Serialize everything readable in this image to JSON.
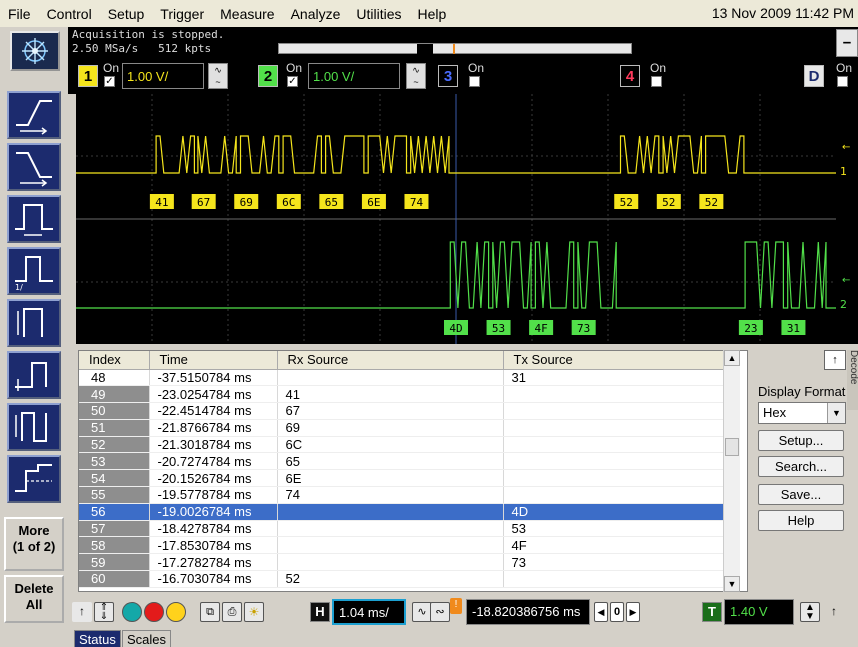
{
  "menu": {
    "items": [
      "File",
      "Control",
      "Setup",
      "Trigger",
      "Measure",
      "Analyze",
      "Utilities",
      "Help"
    ],
    "datetime": "13 Nov 2009 11:42 PM"
  },
  "status": {
    "acquisition": "Acquisition is stopped.",
    "sample_rate": "2.50 MSa/s",
    "memory_depth": "512 kpts",
    "right_button": "−"
  },
  "channels": [
    {
      "num": "1",
      "on_label": "On",
      "scale": "1.00 V/",
      "color": "#f5e51c",
      "enabled": true
    },
    {
      "num": "2",
      "on_label": "On",
      "scale": "1.00 V/",
      "color": "#52e04a",
      "enabled": true
    },
    {
      "num": "3",
      "on_label": "On",
      "color": "#4a6cff",
      "enabled": false
    },
    {
      "num": "4",
      "on_label": "On",
      "color": "#ff3a5c",
      "enabled": false
    },
    {
      "num": "D",
      "on_label": "On",
      "color": "#e8e8e8",
      "enabled": false
    }
  ],
  "scope": {
    "ch1_marker": "1",
    "ch2_marker": "2",
    "ch1_bytes": [
      {
        "label": "41",
        "at": 0.113
      },
      {
        "label": "67",
        "at": 0.168
      },
      {
        "label": "69",
        "at": 0.224
      },
      {
        "label": "6C",
        "at": 0.28
      },
      {
        "label": "65",
        "at": 0.336
      },
      {
        "label": "6E",
        "at": 0.392
      },
      {
        "label": "74",
        "at": 0.448
      },
      {
        "label": "52",
        "at": 0.724
      },
      {
        "label": "52",
        "at": 0.78
      },
      {
        "label": "52",
        "at": 0.836
      }
    ],
    "ch2_bytes": [
      {
        "label": "4D",
        "at": 0.5
      },
      {
        "label": "53",
        "at": 0.556
      },
      {
        "label": "4F",
        "at": 0.612
      },
      {
        "label": "73",
        "at": 0.668
      },
      {
        "label": "23",
        "at": 0.888
      },
      {
        "label": "31",
        "at": 0.944
      }
    ]
  },
  "left_toolbar": {
    "more_label": "More",
    "more_page": "(1 of 2)",
    "delete_label": "Delete",
    "delete_all_label": "All"
  },
  "lister": {
    "columns": [
      "Index",
      "Time",
      "Rx Source",
      "Tx Source"
    ],
    "selected_index": "56",
    "rows": [
      {
        "index": "48",
        "time": "-37.5150784 ms",
        "rx": "",
        "tx": "31"
      },
      {
        "index": "49",
        "time": "-23.0254784 ms",
        "rx": "41",
        "tx": ""
      },
      {
        "index": "50",
        "time": "-22.4514784 ms",
        "rx": "67",
        "tx": ""
      },
      {
        "index": "51",
        "time": "-21.8766784 ms",
        "rx": "69",
        "tx": ""
      },
      {
        "index": "52",
        "time": "-21.3018784 ms",
        "rx": "6C",
        "tx": ""
      },
      {
        "index": "53",
        "time": "-20.7274784 ms",
        "rx": "65",
        "tx": ""
      },
      {
        "index": "54",
        "time": "-20.1526784 ms",
        "rx": "6E",
        "tx": ""
      },
      {
        "index": "55",
        "time": "-19.5778784 ms",
        "rx": "74",
        "tx": ""
      },
      {
        "index": "56",
        "time": "-19.0026784 ms",
        "rx": "",
        "tx": "4D"
      },
      {
        "index": "57",
        "time": "-18.4278784 ms",
        "rx": "",
        "tx": "53"
      },
      {
        "index": "58",
        "time": "-17.8530784 ms",
        "rx": "",
        "tx": "4F"
      },
      {
        "index": "59",
        "time": "-17.2782784 ms",
        "rx": "",
        "tx": "73"
      },
      {
        "index": "60",
        "time": "-16.7030784 ms",
        "rx": "52",
        "tx": ""
      }
    ]
  },
  "panel": {
    "display_format_label": "Display Format",
    "display_format_value": "Hex",
    "setup": "Setup...",
    "search": "Search...",
    "save": "Save...",
    "help": "Help",
    "decode_tab": "Decode"
  },
  "bottom": {
    "timebase": "1.04 ms/",
    "delay": "-18.820386756 ms",
    "delay_step": "0",
    "trigger_level": "1.40 V",
    "trigger_box": "T",
    "h_box": "H"
  },
  "tabs": [
    "Status",
    "Scales"
  ]
}
